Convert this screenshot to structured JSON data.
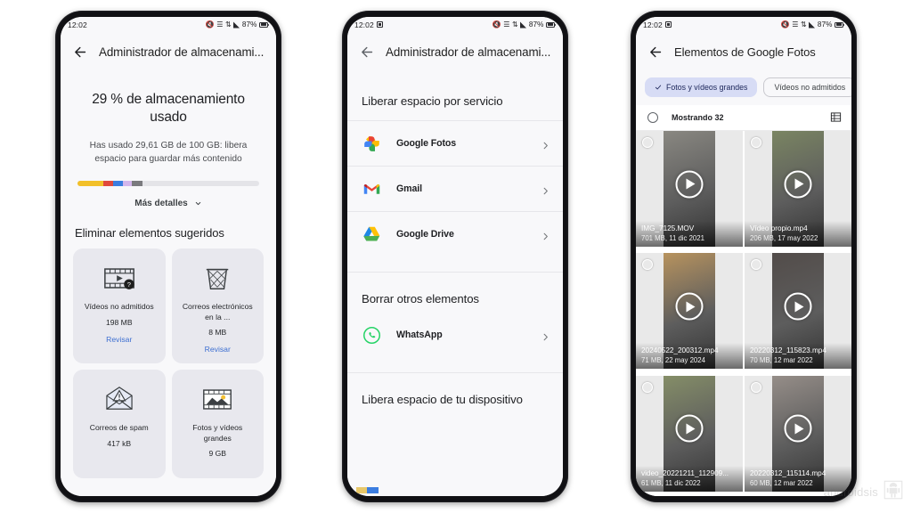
{
  "status_bar": {
    "time": "12:02",
    "battery": "87%"
  },
  "colors": {
    "accent_blue": "#3d6fd1",
    "chip_selected_bg": "#d7dcf5",
    "bar_yellow": "#f2c029",
    "bar_red": "#e0493c",
    "bar_blue": "#3b7de0",
    "bar_purple": "#d3b6ec",
    "bar_grey": "#7a7a7e",
    "bar_track": "#e4e4e8"
  },
  "screen1": {
    "title": "Administrador de almacenami...",
    "back_icon": "back-arrow-icon",
    "hero_title": "29 % de almacenamiento usado",
    "hero_sub": "Has usado 29,61 GB de 100 GB: libera espacio para guardar más contenido",
    "more_details": "Más detalles",
    "usage_bar": [
      {
        "name": "yellow",
        "color": "#f2c029",
        "percent": 14
      },
      {
        "name": "red",
        "color": "#e0493c",
        "percent": 5.5
      },
      {
        "name": "blue",
        "color": "#3b7de0",
        "percent": 5.5
      },
      {
        "name": "purple",
        "color": "#d3b6ec",
        "percent": 5
      },
      {
        "name": "grey",
        "color": "#7a7a7e",
        "percent": 6
      }
    ],
    "section_title": "Eliminar elementos sugeridos",
    "cards": [
      {
        "icon": "unsupported-video-icon",
        "title": "Vídeos no admitidos",
        "size": "198 MB",
        "action": "Revisar"
      },
      {
        "icon": "trash-bin-icon",
        "title": "Correos electrónicos en la ...",
        "size": "8 MB",
        "action": "Revisar"
      },
      {
        "icon": "spam-mail-icon",
        "title": "Correos de spam",
        "size": "417 kB",
        "action": ""
      },
      {
        "icon": "large-photos-icon",
        "title": "Fotos y vídeos grandes",
        "size": "9 GB",
        "action": ""
      }
    ]
  },
  "screen2": {
    "title": "Administrador de almacenami...",
    "section_services": "Liberar espacio por servicio",
    "services": [
      {
        "icon": "google-photos-icon",
        "label": "Google Fotos"
      },
      {
        "icon": "gmail-icon",
        "label": "Gmail"
      },
      {
        "icon": "google-drive-icon",
        "label": "Google Drive"
      }
    ],
    "section_other": "Borrar otros elementos",
    "other": [
      {
        "icon": "whatsapp-icon",
        "label": "WhatsApp"
      }
    ],
    "section_device": "Libera espacio de tu dispositivo"
  },
  "screen3": {
    "title": "Elementos de Google Fotos",
    "chips": [
      {
        "label": "Fotos y vídeos grandes",
        "selected": true,
        "icon": "check-icon"
      },
      {
        "label": "Vídeos no admitidos",
        "selected": false
      }
    ],
    "showing_label": "Mostrando 32",
    "select_all_icon": "radio-unchecked-icon",
    "view_toggle_icon": "grid-view-icon",
    "items": [
      {
        "name": "IMG_7125.MOV",
        "meta": "701 MB, 11 dic 2021",
        "play": true,
        "tone": "#8f8d86"
      },
      {
        "name": "Vídeo propio.mp4",
        "meta": "206 MB, 17 may 2022",
        "play": true,
        "tone": "#7e8a63"
      },
      {
        "name": "20240522_200312.mp4",
        "meta": "71 MB, 22 may 2024",
        "play": true,
        "tone": "#c39a5e"
      },
      {
        "name": "20220312_115823.mp4",
        "meta": "70 MB, 12 mar 2022",
        "play": true,
        "tone": "#514a47"
      },
      {
        "name": "video_20221211_112909...",
        "meta": "61 MB, 11 dic 2022",
        "play": true,
        "tone": "#8a9469"
      },
      {
        "name": "20220312_115114.mp4",
        "meta": "60 MB, 12 mar 2022",
        "play": true,
        "tone": "#9d948e"
      }
    ]
  },
  "watermark": {
    "text": "androidsis",
    "icon": "android-robot-icon"
  }
}
